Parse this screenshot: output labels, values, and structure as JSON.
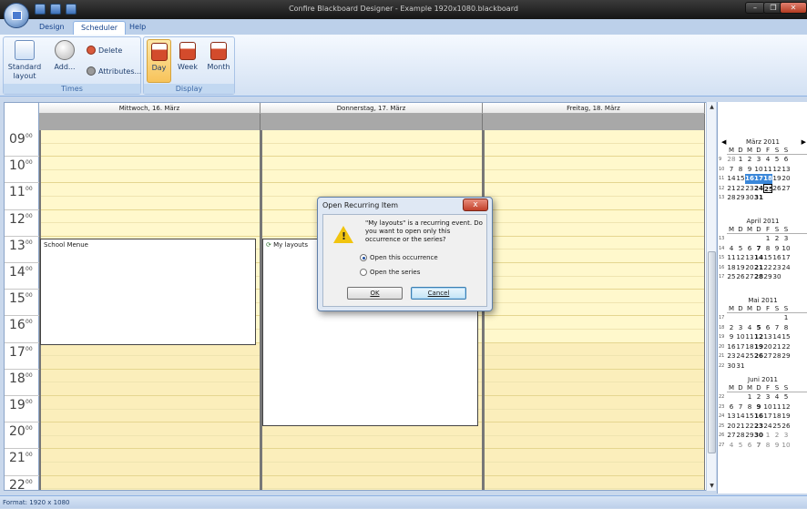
{
  "window": {
    "title": "Confire Blackboard Designer - Example 1920x1080.blackboard"
  },
  "ribbon_tabs": [
    {
      "label": "Design"
    },
    {
      "label": "Scheduler"
    },
    {
      "label": "Help"
    }
  ],
  "ribbon": {
    "times_group": "Times",
    "display_group": "Display",
    "standard_layout": "Standard layout",
    "add": "Add...",
    "delete": "Delete",
    "attributes": "Attributes...",
    "day": "Day",
    "week": "Week",
    "month": "Month"
  },
  "schedule": {
    "days": [
      "Mittwoch, 16. März",
      "Donnerstag, 17. März",
      "Freitag, 18. März"
    ],
    "hours": [
      "09",
      "10",
      "11",
      "12",
      "13",
      "14",
      "15",
      "16",
      "17",
      "18",
      "19",
      "20",
      "21",
      "22"
    ],
    "minute_label": "00",
    "appointments": [
      {
        "title": "School Menue"
      },
      {
        "title": "My layouts"
      }
    ]
  },
  "dialog": {
    "title": "Open Recurring Item",
    "close": "x",
    "message": "\"My layouts\" is a recurring event. Do you want to open only this occurrence or the series?",
    "option_occurrence": "Open this occurrence",
    "option_series": "Open the series",
    "ok": "OK",
    "cancel": "Cancel"
  },
  "navigator": {
    "dow": [
      "M",
      "D",
      "M",
      "D",
      "F",
      "S",
      "S"
    ],
    "months": [
      {
        "name": "März 2011",
        "weeks": [
          {
            "wk": "9",
            "days": [
              "28",
              "1",
              "2",
              "3",
              "4",
              "5",
              "6"
            ]
          },
          {
            "wk": "10",
            "days": [
              "7",
              "8",
              "9",
              "10",
              "11",
              "12",
              "13"
            ]
          },
          {
            "wk": "11",
            "days": [
              "14",
              "15",
              "16",
              "17",
              "18",
              "19",
              "20"
            ]
          },
          {
            "wk": "12",
            "days": [
              "21",
              "22",
              "23",
              "24",
              "25",
              "26",
              "27"
            ]
          },
          {
            "wk": "13",
            "days": [
              "28",
              "29",
              "30",
              "31",
              "",
              "",
              ""
            ]
          }
        ]
      },
      {
        "name": "April 2011",
        "weeks": [
          {
            "wk": "13",
            "days": [
              "",
              "",
              "",
              "",
              "1",
              "2",
              "3"
            ]
          },
          {
            "wk": "14",
            "days": [
              "4",
              "5",
              "6",
              "7",
              "8",
              "9",
              "10"
            ]
          },
          {
            "wk": "15",
            "days": [
              "11",
              "12",
              "13",
              "14",
              "15",
              "16",
              "17"
            ]
          },
          {
            "wk": "16",
            "days": [
              "18",
              "19",
              "20",
              "21",
              "22",
              "23",
              "24"
            ]
          },
          {
            "wk": "17",
            "days": [
              "25",
              "26",
              "27",
              "28",
              "29",
              "30",
              ""
            ]
          }
        ]
      },
      {
        "name": "Mai 2011",
        "weeks": [
          {
            "wk": "17",
            "days": [
              "",
              "",
              "",
              "",
              "",
              "",
              "1"
            ]
          },
          {
            "wk": "18",
            "days": [
              "2",
              "3",
              "4",
              "5",
              "6",
              "7",
              "8"
            ]
          },
          {
            "wk": "19",
            "days": [
              "9",
              "10",
              "11",
              "12",
              "13",
              "14",
              "15"
            ]
          },
          {
            "wk": "20",
            "days": [
              "16",
              "17",
              "18",
              "19",
              "20",
              "21",
              "22"
            ]
          },
          {
            "wk": "21",
            "days": [
              "23",
              "24",
              "25",
              "26",
              "27",
              "28",
              "29"
            ]
          },
          {
            "wk": "22",
            "days": [
              "30",
              "31",
              "",
              "",
              "",
              "",
              ""
            ]
          }
        ]
      },
      {
        "name": "Juni 2011",
        "weeks": [
          {
            "wk": "22",
            "days": [
              "",
              "",
              "1",
              "2",
              "3",
              "4",
              "5"
            ]
          },
          {
            "wk": "23",
            "days": [
              "6",
              "7",
              "8",
              "9",
              "10",
              "11",
              "12"
            ]
          },
          {
            "wk": "24",
            "days": [
              "13",
              "14",
              "15",
              "16",
              "17",
              "18",
              "19"
            ]
          },
          {
            "wk": "25",
            "days": [
              "20",
              "21",
              "22",
              "23",
              "24",
              "25",
              "26"
            ]
          },
          {
            "wk": "26",
            "days": [
              "27",
              "28",
              "29",
              "30",
              "1",
              "2",
              "3"
            ]
          },
          {
            "wk": "27",
            "days": [
              "4",
              "5",
              "6",
              "7",
              "8",
              "9",
              "10"
            ]
          }
        ]
      }
    ]
  },
  "status": {
    "text": "Format: 1920 x 1080"
  }
}
